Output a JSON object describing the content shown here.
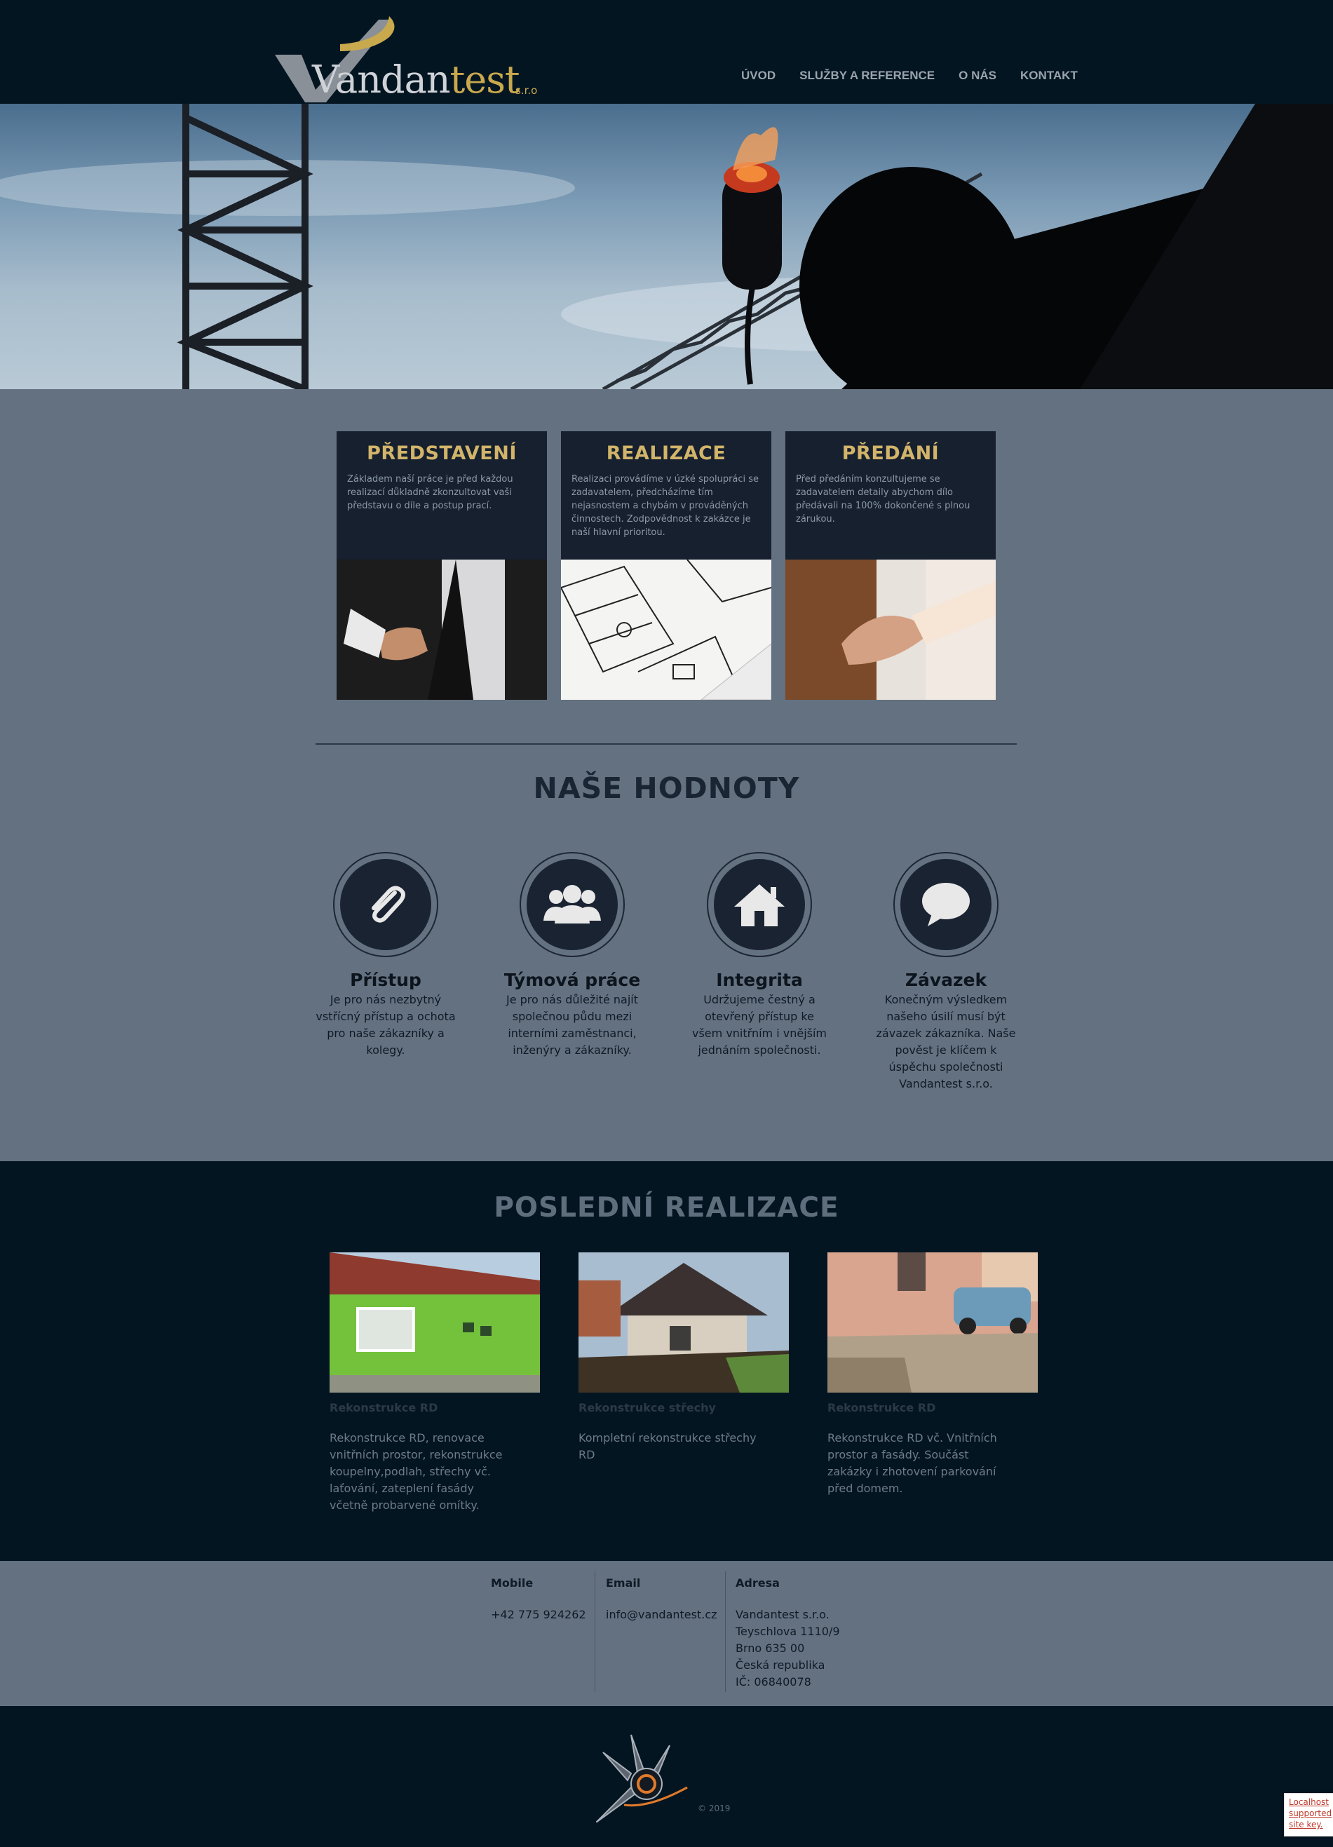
{
  "header": {
    "logo_text_main": "Vandan",
    "logo_text_accent": "test",
    "logo_suffix": "s.r.o",
    "nav": [
      {
        "label": "ÚVOD"
      },
      {
        "label": "SLUŽBY A REFERENCE"
      },
      {
        "label": "O NÁS"
      },
      {
        "label": "KONTAKT"
      }
    ]
  },
  "cards": [
    {
      "title": "PŘEDSTAVENÍ",
      "text": "Základem naší práce je před každou realizací důkladně zkonzultovat vaši představu o díle a postup prací.",
      "image": "handshake-offer-photo"
    },
    {
      "title": "REALIZACE",
      "text": "Realizaci provádíme v úzké spolupráci se zadavatelem, předcházíme tím nejasnostem a chybám v prováděných činnostech. Zodpovědnost k zakázce je naší hlavní prioritou.",
      "image": "floor-plan-photo"
    },
    {
      "title": "PŘEDÁNÍ",
      "text": "Před předáním konzultujeme se zadavatelem detaily abychom dílo předávali na 100% dokončené s plnou zárukou.",
      "image": "handshake-photo"
    }
  ],
  "values": {
    "title": "NAŠE HODNOTY",
    "items": [
      {
        "title": "Přístup",
        "icon": "paperclip-icon",
        "text": "Je pro nás nezbytný vstřícný přístup a ochota pro naše zákazníky a kolegy."
      },
      {
        "title": "Týmová práce",
        "icon": "team-icon",
        "text": "Je pro nás důležité najít společnou půdu mezi interními zaměstnanci, inženýry a zákazníky."
      },
      {
        "title": "Integrita",
        "icon": "home-icon",
        "text": "Udržujeme čestný a otevřený přístup ke všem vnitřním i vnějším jednáním společnosti."
      },
      {
        "title": "Závazek",
        "icon": "speech-bubble-icon",
        "text": "Konečným výsledkem našeho úsilí musí být závazek zákazníka. Naše pověst je klíčem k úspěchu společnosti Vandantest s.r.o."
      }
    ]
  },
  "realizace": {
    "title": "POSLEDNÍ REALIZACE",
    "projects": [
      {
        "title": "Rekonstrukce RD",
        "text": "Rekonstrukce RD, renovace vnitřních prostor, rekonstrukce koupelny,podlah, střechy vč. laťování, zateplení fasády včetně probarvené omítky."
      },
      {
        "title": "Rekonstrukce střechy",
        "text": "Kompletní rekonstrukce střechy RD"
      },
      {
        "title": "Rekonstrukce RD",
        "text": "Rekonstrukce RD vč. Vnitřních prostor a fasády. Součást zakázky i zhotovení parkování před domem."
      }
    ]
  },
  "contact": {
    "mobile_label": "Mobile",
    "mobile_value": "+42 775 924262",
    "email_label": "Email",
    "email_value": "info@vandantest.cz",
    "address_label": "Adresa",
    "address_lines": [
      "Vandantest s.r.o.",
      "Teyschlova 1110/9",
      "Brno 635 00",
      "Česká republika",
      "IČ: 06840078"
    ]
  },
  "footer": {
    "copyright": "© 2019",
    "badge_logo": "smart-graphic-logo"
  },
  "recaptcha": {
    "lines": [
      "Localhost",
      "supported",
      "site key."
    ]
  },
  "colors": {
    "header_bg": "#041522",
    "body_bg": "#647181",
    "card_bg": "#16202e",
    "gold": "#d2b46a"
  }
}
